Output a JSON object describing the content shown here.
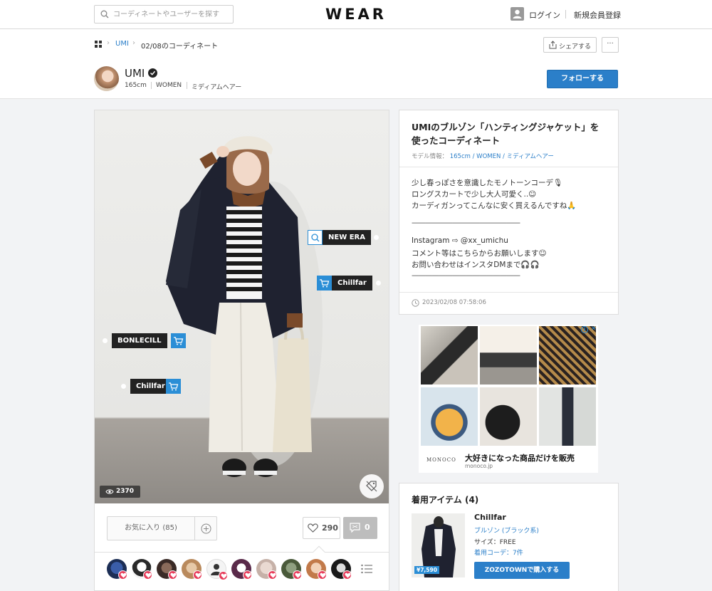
{
  "header": {
    "search_placeholder": "コーディネートやユーザーを探す",
    "logo": "WEAR",
    "login_label": "ログイン",
    "register_label": "新規会員登録"
  },
  "breadcrumb": {
    "user": "UMI",
    "current": "02/08のコーディネート"
  },
  "actions": {
    "share_label": "シェアする",
    "more_label": "···"
  },
  "profile": {
    "name": "UMI",
    "height": "165cm",
    "gender": "WOMEN",
    "hair": "ミディアムヘアー",
    "follow_label": "フォローする"
  },
  "photo": {
    "views": "2370",
    "tags": [
      {
        "label": "NEW ERA",
        "icon": "search-icon"
      },
      {
        "label": "Chillfar",
        "icon": "cart-icon"
      },
      {
        "label": "BONLECILL",
        "icon": "cart-icon"
      },
      {
        "label": "Chillfar",
        "icon": "cart-icon"
      }
    ]
  },
  "reactions": {
    "favorite_label": "お気に入り (85)",
    "likes": "290",
    "comments": "0",
    "liker_count": 10
  },
  "info": {
    "title": "UMIのブルゾン「ハンティングジャケット」を使ったコーディネート",
    "model_label": "モデル情報：",
    "model_value": "165cm / WOMEN / ミディアムヘアー",
    "description": [
      "少し春っぽさを意識したモノトーンコーデ🎙",
      "ロングスカートで少し大人可愛く..☺",
      "カーディガンってこんなに安く買えるんですね🙏",
      "",
      "————————————————",
      "Instagram ⇨ @xx_umichu",
      "コメント等はこちらからお願いします☺",
      "お問い合わせはインスタDMまで🎧🎧",
      "————————————————"
    ],
    "date": "2023/02/08 07:58:06"
  },
  "ad": {
    "brand": "MONOCO",
    "headline": "大好きになった商品だけを販売",
    "url": "monoco.jp"
  },
  "items": {
    "title": "着用アイテム (4)",
    "first": {
      "brand": "Chillfar",
      "category": "ブルゾン (ブラック系)",
      "size": "サイズ：FREE",
      "coordinates": "着用コーデ：7件",
      "price": "¥7,590",
      "buy_label": "ZOZOTOWNで購入する"
    }
  },
  "colors": {
    "accent": "#2b7fc9",
    "tag_bg": "#222222",
    "heart": "#e73c5a"
  }
}
